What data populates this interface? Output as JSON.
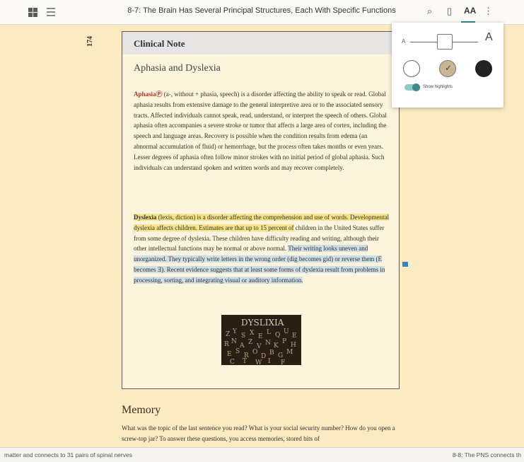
{
  "header": {
    "title": "8-7: The Brain Has Several Principal Structures, Each With Specific Functions",
    "search_icon": "⌕",
    "bookmark_icon": "▯",
    "font_settings_label": "AA",
    "more_icon": "⋮"
  },
  "page": {
    "number": "174"
  },
  "clinical_note": {
    "label": "Clinical Note",
    "title": "Aphasia and Dyslexia",
    "p1_term": "Aphasia",
    "p1_mark": "Ⓟ",
    "p1_text": " (a-, without + phasia, speech) is a disorder affecting the ability to speak or read. Global aphasia results from extensive damage to the general interpretive area or to the associated sensory tracts. Affected individuals cannot speak, read, understand, or interpret the speech of others. Global aphasia often accompanies a severe stroke or tumor that affects a large area of cortex, including the speech and language areas. Recovery is possible when the condition results from edema (an abnormal accumulation of fluid) or hemorrhage, but the process often takes months or even years. Lesser degrees of aphasia often follow minor strokes with no initial period of global aphasia. Such individuals can understand spoken and written words and may recover completely.",
    "p2_term": "Dyslexia",
    "p2_yellow": " (lexis, diction) is a disorder affecting the comprehension and use of words. Developmental dyslexia affects children. Estimates are that up to 15 percent of",
    "p2_plain": " children in the United States suffer from some degree of dyslexia. These children have difficulty reading and writing, although their other intellectual functions may be normal or above normal. ",
    "p2_blue": "Their writing looks uneven and unorganized. They typically write letters in the wrong order (dig becomes gid) or reverse them (E becomes Ǝ). Recent evidence suggests that at least some forms of dyslexia result from problems in processing, sorting, and integrating visual or auditory information.",
    "image_text": "DYSLIXIA"
  },
  "memory": {
    "heading": "Memory",
    "text": "What was the topic of the last sentence you read? What is your social security number? How do you open a screw-top jar? To answer these questions, you access memories, stored bits of"
  },
  "footer": {
    "left": "matter and connects to 31 pairs of spinal nerves",
    "right": "8-8: The PNS connects th"
  },
  "settings_popover": {
    "small_a": "A",
    "large_a": "A",
    "font_size_level": 0.5,
    "themes": [
      "white",
      "sepia",
      "black"
    ],
    "selected_theme": "sepia",
    "check_icon": "✓",
    "highlights_toggle_label": "Show highlights",
    "highlights_on": true
  },
  "colors": {
    "background": "#faebc3",
    "accent": "#3e8a8a",
    "highlight_yellow": "#f4e48a",
    "highlight_blue": "#cde0ea",
    "note_marker": "#3b7fc4"
  }
}
